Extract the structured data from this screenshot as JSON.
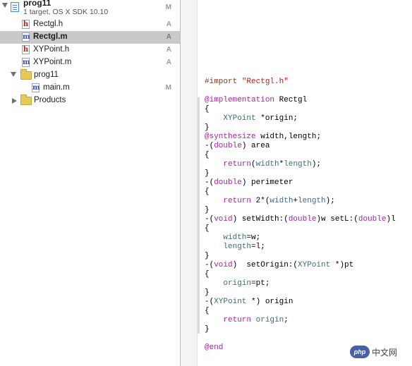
{
  "navigator": {
    "project": {
      "name": "prog11",
      "subtitle": "1 target, OS X SDK 10.10",
      "status": "M"
    },
    "items": [
      {
        "name": "Rectgl.h",
        "kind": "h",
        "status": "A",
        "selected": false
      },
      {
        "name": "Rectgl.m",
        "kind": "m",
        "status": "A",
        "selected": true
      },
      {
        "name": "XYPoint.h",
        "kind": "h",
        "status": "A",
        "selected": false
      },
      {
        "name": "XYPoint.m",
        "kind": "m",
        "status": "A",
        "selected": false
      }
    ],
    "group": {
      "name": "prog11"
    },
    "group_items": [
      {
        "name": "main.m",
        "kind": "m",
        "status": "M"
      }
    ],
    "products": {
      "name": "Products"
    }
  },
  "editor": {
    "lines": [
      [
        [
          "pp",
          "#import "
        ],
        [
          "str",
          "\"Rectgl.h\""
        ]
      ],
      [],
      [
        [
          "kw",
          "@implementation"
        ],
        [
          "",
          " Rectgl"
        ]
      ],
      [
        [
          "",
          "{"
        ]
      ],
      [
        [
          "",
          "    "
        ],
        [
          "ty",
          "XYPoint"
        ],
        [
          "",
          " *origin;"
        ]
      ],
      [
        [
          "",
          "}"
        ]
      ],
      [
        [
          "kw",
          "@synthesize"
        ],
        [
          "",
          " width,length;"
        ]
      ],
      [
        [
          "",
          "-("
        ],
        [
          "kw",
          "double"
        ],
        [
          "",
          ") area"
        ]
      ],
      [
        [
          "",
          "{"
        ]
      ],
      [
        [
          "",
          "    "
        ],
        [
          "kw",
          "return"
        ],
        [
          "",
          "("
        ],
        [
          "ty",
          "width"
        ],
        [
          "",
          "*"
        ],
        [
          "ty",
          "length"
        ],
        [
          "",
          ");"
        ]
      ],
      [
        [
          "",
          "}"
        ]
      ],
      [
        [
          "",
          "-("
        ],
        [
          "kw",
          "double"
        ],
        [
          "",
          ") perimeter"
        ]
      ],
      [
        [
          "",
          "{"
        ]
      ],
      [
        [
          "",
          "    "
        ],
        [
          "kw",
          "return"
        ],
        [
          "",
          " 2*("
        ],
        [
          "ty",
          "width"
        ],
        [
          "",
          "+"
        ],
        [
          "ty",
          "length"
        ],
        [
          "",
          ");"
        ]
      ],
      [
        [
          "",
          "}"
        ]
      ],
      [
        [
          "",
          "-("
        ],
        [
          "kw",
          "void"
        ],
        [
          "",
          ") setWidth:("
        ],
        [
          "kw",
          "double"
        ],
        [
          "",
          ")w setL:("
        ],
        [
          "kw",
          "double"
        ],
        [
          "",
          ")l"
        ]
      ],
      [
        [
          "",
          "{"
        ]
      ],
      [
        [
          "",
          "    "
        ],
        [
          "ty",
          "width"
        ],
        [
          "",
          "=w;"
        ]
      ],
      [
        [
          "",
          "    "
        ],
        [
          "ty",
          "length"
        ],
        [
          "",
          "=l;"
        ]
      ],
      [
        [
          "",
          "}"
        ]
      ],
      [
        [
          "",
          "-("
        ],
        [
          "kw",
          "void"
        ],
        [
          "",
          ")  setOrigin:("
        ],
        [
          "ty",
          "XYPoint"
        ],
        [
          "",
          " *)pt"
        ]
      ],
      [
        [
          "",
          "{"
        ]
      ],
      [
        [
          "",
          "    "
        ],
        [
          "ty",
          "origin"
        ],
        [
          "",
          "=pt;"
        ]
      ],
      [
        [
          "",
          "}"
        ]
      ],
      [
        [
          "",
          "-("
        ],
        [
          "ty",
          "XYPoint"
        ],
        [
          "",
          " *) origin"
        ]
      ],
      [
        [
          "",
          "{"
        ]
      ],
      [
        [
          "",
          "    "
        ],
        [
          "kw",
          "return"
        ],
        [
          "",
          " "
        ],
        [
          "ty",
          "origin"
        ],
        [
          "",
          ";"
        ]
      ],
      [
        [
          "",
          "}"
        ]
      ],
      [],
      [
        [
          "kw",
          "@end"
        ]
      ]
    ]
  },
  "watermark": {
    "logo": "php",
    "text": "中文网"
  },
  "colors": {
    "selection": "#c9c9c9",
    "keyword": "#a1289e",
    "string": "#c41a16",
    "preprocessor": "#7b3f23",
    "type": "#3f6e74"
  }
}
